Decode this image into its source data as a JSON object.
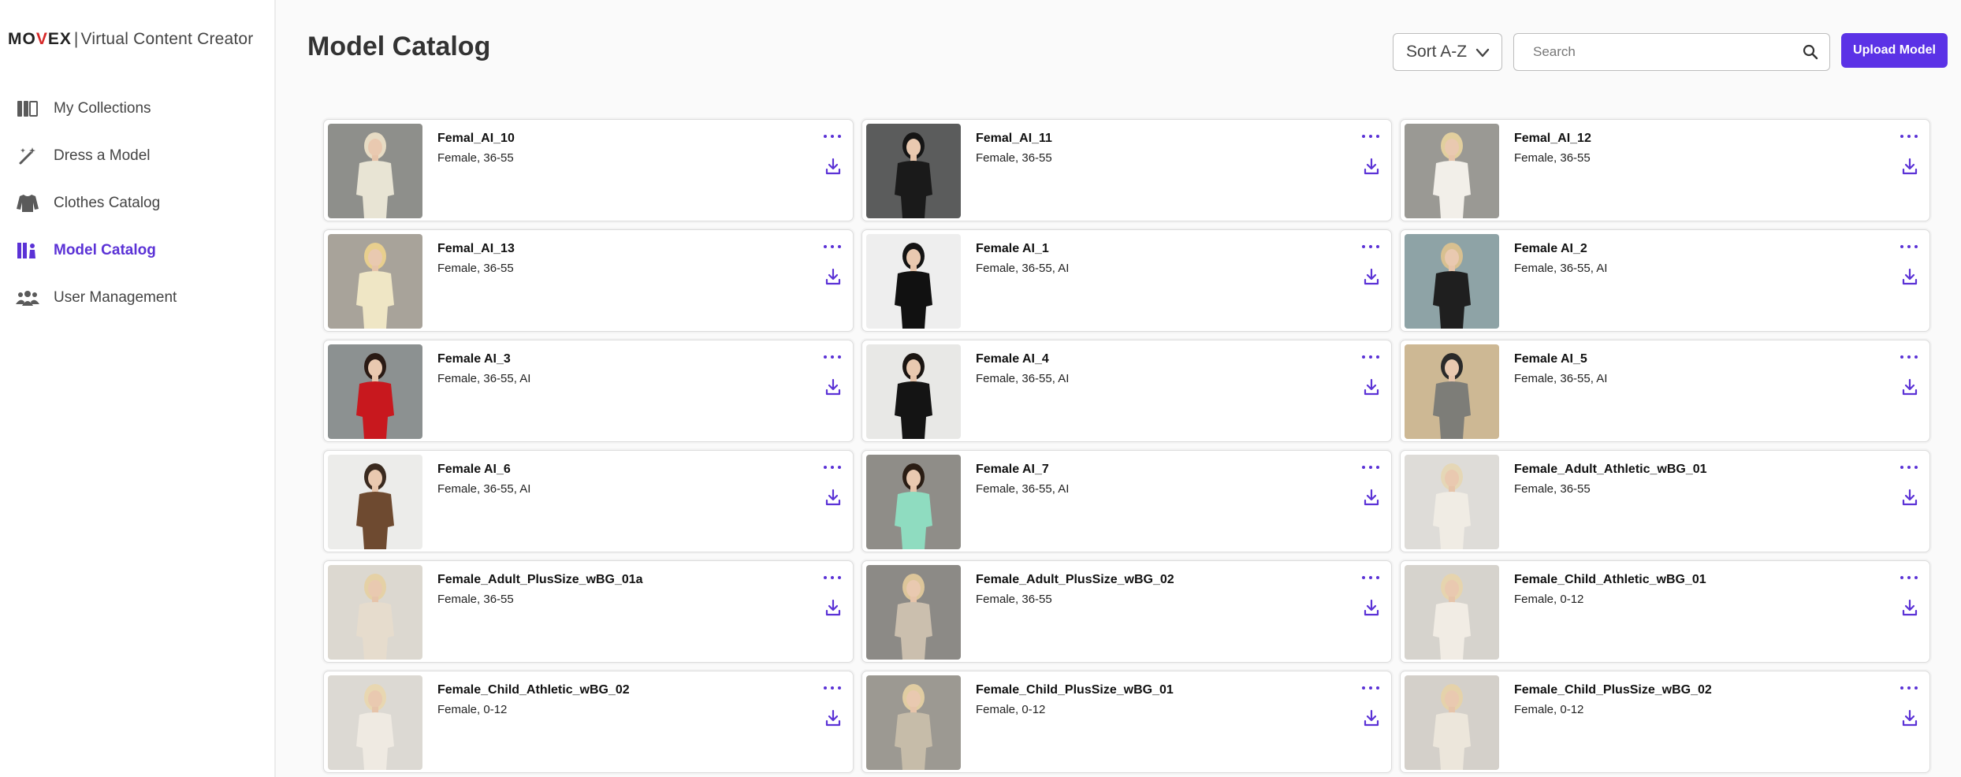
{
  "brand": {
    "logo": "MOVEX",
    "separator": "|",
    "product": "Virtual Content Creator"
  },
  "sidebar": {
    "items": [
      {
        "label": "My Collections",
        "icon": "collections-icon",
        "active": false
      },
      {
        "label": "Dress a Model",
        "icon": "magic-wand-icon",
        "active": false
      },
      {
        "label": "Clothes Catalog",
        "icon": "sweater-icon",
        "active": false
      },
      {
        "label": "Model Catalog",
        "icon": "model-catalog-icon",
        "active": true
      },
      {
        "label": "User Management",
        "icon": "users-icon",
        "active": false
      }
    ]
  },
  "header": {
    "title": "Model Catalog",
    "sort_value": "Sort A-Z",
    "search_placeholder": "Search",
    "search_value": "",
    "upload_label": "Upload Model"
  },
  "colors": {
    "accent": "#5b32e6",
    "brand_red": "#d62828"
  },
  "models": [
    {
      "name": "Femal_AI_10",
      "meta": "Female, 36-55",
      "bg": "#8e8f8b",
      "figure": "#e8e4d4",
      "hair": "#e7dcc4"
    },
    {
      "name": "Femal_AI_11",
      "meta": "Female, 36-55",
      "bg": "#5b5c5c",
      "figure": "#1a1a1a",
      "hair": "#151515"
    },
    {
      "name": "Femal_AI_12",
      "meta": "Female, 36-55",
      "bg": "#9a9994",
      "figure": "#f2efe9",
      "hair": "#e2cf9e"
    },
    {
      "name": "Femal_AI_13",
      "meta": "Female, 36-55",
      "bg": "#a8a39a",
      "figure": "#efe6c5",
      "hair": "#e8cf8e"
    },
    {
      "name": "Female AI_1",
      "meta": "Female, 36-55, AI",
      "bg": "#eeeeee",
      "figure": "#111111",
      "hair": "#141414"
    },
    {
      "name": "Female AI_2",
      "meta": "Female, 36-55, AI",
      "bg": "#8ea3a6",
      "figure": "#1f1f1f",
      "hair": "#d8c090"
    },
    {
      "name": "Female AI_3",
      "meta": "Female, 36-55, AI",
      "bg": "#8c9191",
      "figure": "#c8181e",
      "hair": "#2a1a14"
    },
    {
      "name": "Female AI_4",
      "meta": "Female, 36-55, AI",
      "bg": "#e8e8e6",
      "figure": "#141414",
      "hair": "#1a1512"
    },
    {
      "name": "Female AI_5",
      "meta": "Female, 36-55, AI",
      "bg": "#cdb894",
      "figure": "#7d7d78",
      "hair": "#2a2a2a"
    },
    {
      "name": "Female AI_6",
      "meta": "Female, 36-55, AI",
      "bg": "#ececea",
      "figure": "#6e4a30",
      "hair": "#3a2a1f"
    },
    {
      "name": "Female AI_7",
      "meta": "Female, 36-55, AI",
      "bg": "#8f8d88",
      "figure": "#8fdcc0",
      "hair": "#2a1d14"
    },
    {
      "name": "Female_Adult_Athletic_wBG_01",
      "meta": "Female, 36-55",
      "bg": "#dedcd8",
      "figure": "#f0ece4",
      "hair": "#e5d7b6"
    },
    {
      "name": "Female_Adult_PlusSize_wBG_01a",
      "meta": "Female, 36-55",
      "bg": "#dcd8d0",
      "figure": "#e6dccd",
      "hair": "#e5d1a6"
    },
    {
      "name": "Female_Adult_PlusSize_wBG_02",
      "meta": "Female, 36-55",
      "bg": "#8c8a86",
      "figure": "#cbbfae",
      "hair": "#ddc69a"
    },
    {
      "name": "Female_Child_Athletic_wBG_01",
      "meta": "Female, 0-12",
      "bg": "#d6d3cd",
      "figure": "#f1ece4",
      "hair": "#e6d4ae"
    },
    {
      "name": "Female_Child_Athletic_wBG_02",
      "meta": "Female, 0-12",
      "bg": "#dcd9d3",
      "figure": "#efeae2",
      "hair": "#e8d7b1"
    },
    {
      "name": "Female_Child_PlusSize_wBG_01",
      "meta": "Female, 0-12",
      "bg": "#9c9992",
      "figure": "#c6bca9",
      "hair": "#e1cda2"
    },
    {
      "name": "Female_Child_PlusSize_wBG_02",
      "meta": "Female, 0-12",
      "bg": "#d4d0ca",
      "figure": "#ece6db",
      "hair": "#e5d2aa"
    }
  ]
}
